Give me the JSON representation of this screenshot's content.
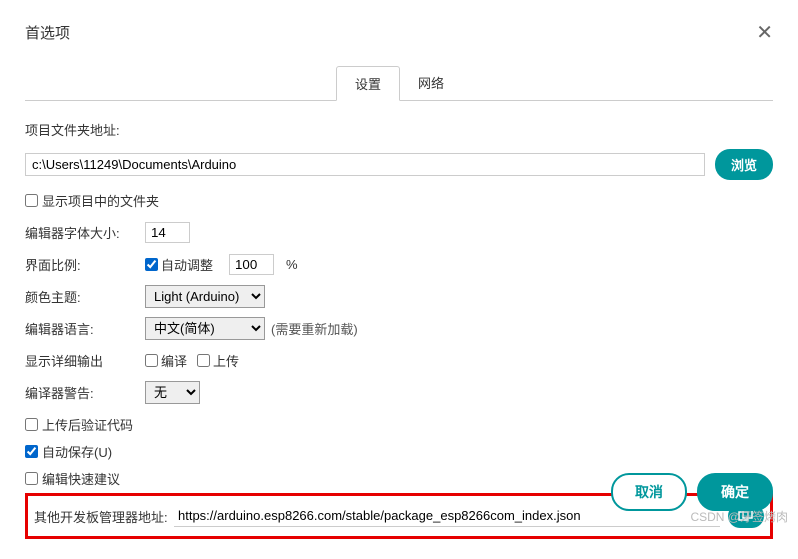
{
  "dialog": {
    "title": "首选项",
    "tabs": {
      "settings": "设置",
      "network": "网络"
    }
  },
  "form": {
    "sketch_location_label": "项目文件夹地址:",
    "sketch_location_value": "c:\\Users\\11249\\Documents\\Arduino",
    "browse_label": "浏览",
    "show_files_label": "显示项目中的文件夹",
    "font_size_label": "编辑器字体大小:",
    "font_size_value": "14",
    "scale_label": "界面比例:",
    "auto_adjust_label": "自动调整",
    "scale_value": "100",
    "scale_unit": "%",
    "theme_label": "颜色主题:",
    "theme_value": "Light (Arduino)",
    "lang_label": "编辑器语言:",
    "lang_value": "中文(简体)",
    "lang_hint": "(需要重新加载)",
    "verbose_label": "显示详细输出",
    "verbose_compile": "编译",
    "verbose_upload": "上传",
    "warnings_label": "编译器警告:",
    "warnings_value": "无",
    "verify_after_upload": "上传后验证代码",
    "autosave": "自动保存(U)",
    "quick_suggest": "编辑快速建议",
    "board_urls_label": "其他开发板管理器地址:",
    "board_urls_value": "https://arduino.esp8266.com/stable/package_esp8266com_index.json"
  },
  "footer": {
    "cancel": "取消",
    "ok": "确定"
  },
  "watermark": "CSDN @牙签烤肉"
}
